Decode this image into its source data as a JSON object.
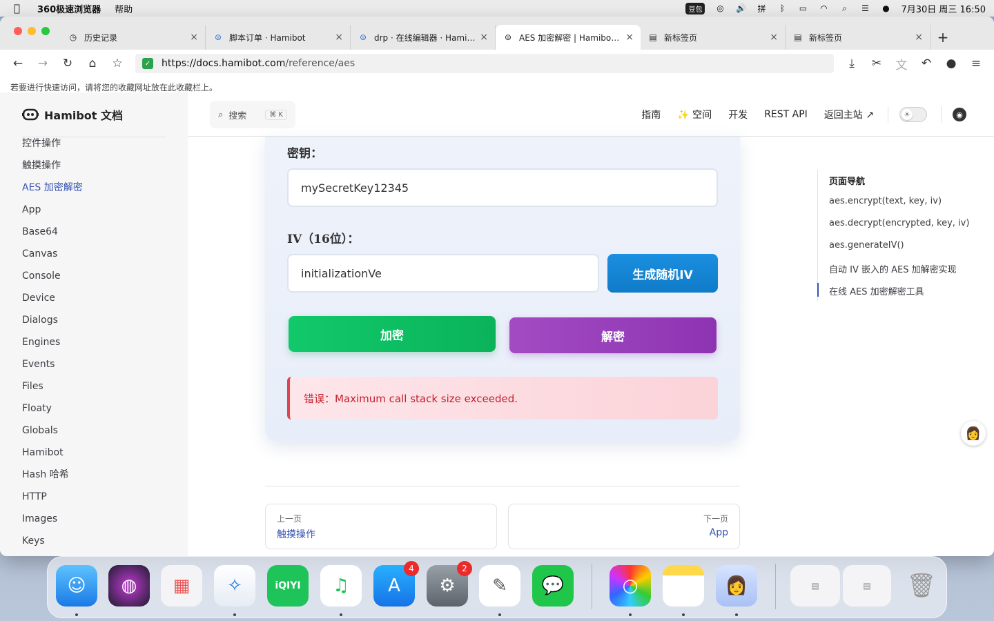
{
  "menubar": {
    "app_name": "360极速浏览器",
    "menu_help": "帮助",
    "doubao": "豆包",
    "datetime": "7月30日 周三  16:50"
  },
  "tabs": [
    {
      "title": "历史记录",
      "icon": "clock-icon"
    },
    {
      "title": "脚本订单 · Hamibot",
      "icon": "hamibot-icon"
    },
    {
      "title": "drp · 在线编辑器 · Hami…",
      "icon": "hamibot-icon"
    },
    {
      "title": "AES 加密解密 | Hamibot …",
      "icon": "hamibot-icon"
    },
    {
      "title": "新标签页",
      "icon": "newtab-icon"
    },
    {
      "title": "新标签页",
      "icon": "newtab-icon"
    }
  ],
  "address": {
    "domain": "https://docs.hamibot.com",
    "path": "/reference/aes"
  },
  "bookmark_hint": "若要进行快速访问，请将您的收藏网址放在此收藏栏上。",
  "site": {
    "logo_text": "Hamibot 文档",
    "search_label": "搜索",
    "search_kbd": "⌘ K",
    "nav": [
      "指南",
      "✨ 空间",
      "开发",
      "REST API",
      "返回主站 ↗"
    ]
  },
  "sidebar": {
    "items": [
      "控件操作",
      "触摸操作",
      "AES 加密解密",
      "App",
      "Base64",
      "Canvas",
      "Console",
      "Device",
      "Dialogs",
      "Engines",
      "Events",
      "Files",
      "Floaty",
      "Globals",
      "Hamibot",
      "Hash 哈希",
      "HTTP",
      "Images",
      "Keys"
    ],
    "active_index": 2
  },
  "tool": {
    "key_label": "密钥：",
    "key_value": "mySecretKey12345",
    "iv_label": "IV（16位）：",
    "iv_value": "initializationVe",
    "gen_iv_button": "生成随机IV",
    "encrypt_button": "加密",
    "decrypt_button": "解密",
    "error_text": "错误：Maximum call stack size exceeded."
  },
  "pager": {
    "prev_label": "上一页",
    "prev_title": "触摸操作",
    "next_label": "下一页",
    "next_title": "App"
  },
  "toc": {
    "title": "页面导航",
    "items": [
      "aes.encrypt(text, key, iv)",
      "aes.decrypt(encrypted, key, iv)",
      "aes.generateIV()",
      "自动 IV 嵌入的 AES 加解密实现",
      "在线 AES 加密解密工具"
    ],
    "active_index": 4
  },
  "dock": {
    "apps": [
      "Finder",
      "Siri",
      "Launchpad",
      "Safari",
      "iQIYI",
      "QQ Music",
      "App Store",
      "System Settings",
      "TextEdit",
      "WeChat",
      "Color Picker",
      "Notes",
      "Avatar App",
      "Recent Window",
      "Trash"
    ],
    "app_store_badge": "4",
    "settings_badge": "2"
  },
  "colors": {
    "accent": "#3451b2",
    "encrypt": "#11c96a",
    "decrypt": "#9a40bd",
    "gen_iv": "#1b8fe0",
    "error": "#c6202b"
  }
}
